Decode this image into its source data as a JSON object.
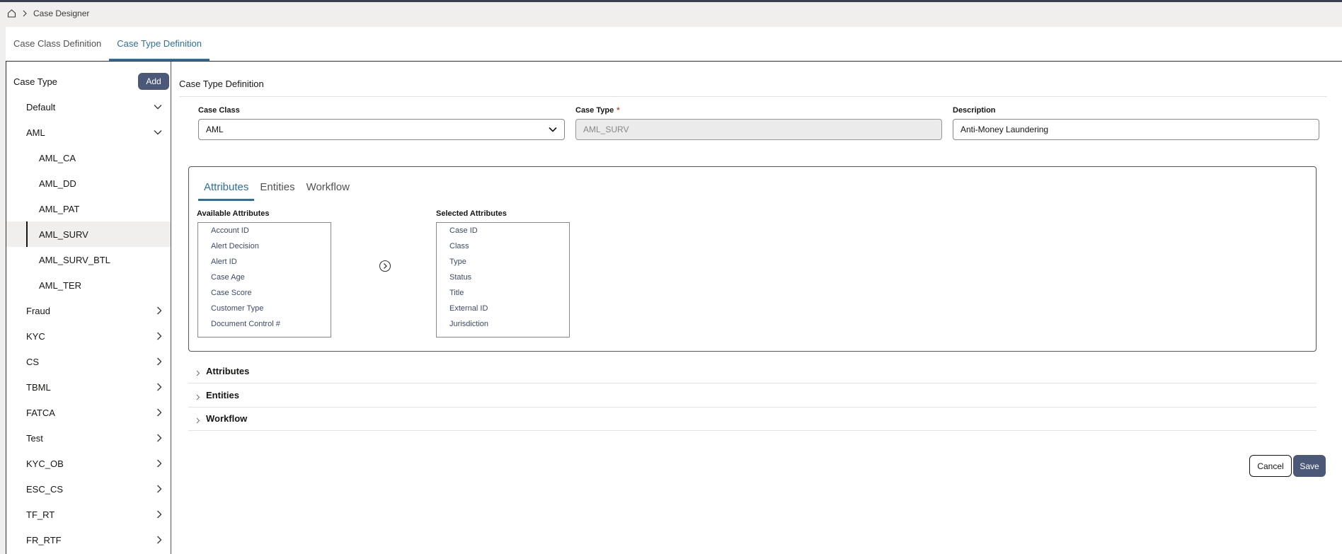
{
  "breadcrumb": {
    "home_icon": "home-icon",
    "separator_icon": "chevron-right-icon",
    "current": "Case Designer"
  },
  "tabs": [
    {
      "label": "Case Class Definition",
      "active": false
    },
    {
      "label": "Case Type Definition",
      "active": true
    }
  ],
  "sidebar": {
    "title": "Case Type",
    "add_label": "Add",
    "items": [
      {
        "label": "Default",
        "level": 0,
        "expanded": true
      },
      {
        "label": "AML",
        "level": 0,
        "expanded": true
      },
      {
        "label": "AML_CA",
        "level": 1
      },
      {
        "label": "AML_DD",
        "level": 1
      },
      {
        "label": "AML_PAT",
        "level": 1
      },
      {
        "label": "AML_SURV",
        "level": 1,
        "selected": true
      },
      {
        "label": "AML_SURV_BTL",
        "level": 1
      },
      {
        "label": "AML_TER",
        "level": 1
      },
      {
        "label": "Fraud",
        "level": 0,
        "expanded": false
      },
      {
        "label": "KYC",
        "level": 0,
        "expanded": false
      },
      {
        "label": "CS",
        "level": 0,
        "expanded": false
      },
      {
        "label": "TBML",
        "level": 0,
        "expanded": false
      },
      {
        "label": "FATCA",
        "level": 0,
        "expanded": false
      },
      {
        "label": "Test",
        "level": 0,
        "expanded": false
      },
      {
        "label": "KYC_OB",
        "level": 0,
        "expanded": false
      },
      {
        "label": "ESC_CS",
        "level": 0,
        "expanded": false
      },
      {
        "label": "TF_RT",
        "level": 0,
        "expanded": false
      },
      {
        "label": "FR_RTF",
        "level": 0,
        "expanded": false
      }
    ]
  },
  "main": {
    "section_title": "Case Type Definition",
    "case_class": {
      "label": "Case Class",
      "value": "AML"
    },
    "case_type": {
      "label": "Case Type",
      "required_mark": "*",
      "value": "AML_SURV"
    },
    "description": {
      "label": "Description",
      "value": "Anti-Money Laundering"
    },
    "inner_tabs": [
      {
        "label": "Attributes",
        "active": true
      },
      {
        "label": "Entities",
        "active": false
      },
      {
        "label": "Workflow",
        "active": false
      }
    ],
    "available_label": "Available Attributes",
    "available": [
      "Account ID",
      "Alert Decision",
      "Alert ID",
      "Case Age",
      "Case Score",
      "Customer Type",
      "Document Control #"
    ],
    "selected_label": "Selected Attributes",
    "selected": [
      "Case ID",
      "Class",
      "Type",
      "Status",
      "Title",
      "External ID",
      "Jurisdiction"
    ],
    "accordions": [
      "Attributes",
      "Entities",
      "Workflow"
    ],
    "cancel_label": "Cancel",
    "save_label": "Save"
  },
  "colors": {
    "accent": "#2c6ea6",
    "primary_button": "#4c5878",
    "required": "#c74634"
  }
}
